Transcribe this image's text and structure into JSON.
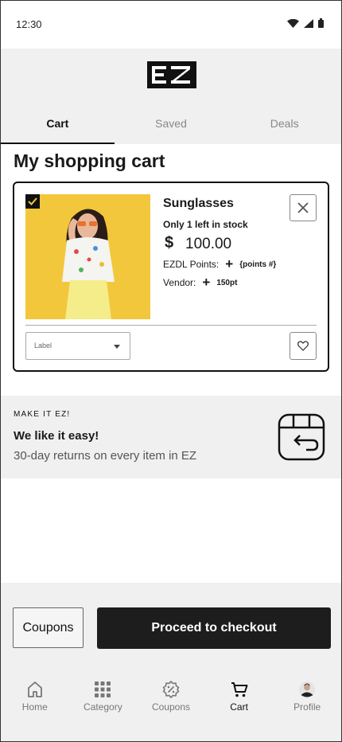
{
  "status": {
    "time": "12:30"
  },
  "brand": {
    "logo_text": "EZ"
  },
  "tabs": [
    {
      "label": "Cart",
      "active": true
    },
    {
      "label": "Saved",
      "active": false
    },
    {
      "label": "Deals",
      "active": false
    }
  ],
  "page": {
    "title": "My shopping cart"
  },
  "cart_item": {
    "checked": true,
    "name": "Sunglasses",
    "stock_note": "Only 1 left in stock",
    "currency_symbol": "$",
    "price": "100.00",
    "points_label": "EZDL Points:",
    "points_value": "{points #}",
    "vendor_label": "Vendor:",
    "vendor_value": "150pt",
    "select_label": "Label",
    "image_icon": "product-photo"
  },
  "promo": {
    "eyebrow": "MAKE IT EZ!",
    "title": "We like it easy!",
    "text": "30-day returns on every item in EZ",
    "icon": "return-box-icon"
  },
  "actions": {
    "coupons_label": "Coupons",
    "checkout_label": "Proceed to checkout"
  },
  "bottom_nav": [
    {
      "label": "Home",
      "icon": "home-icon",
      "active": false
    },
    {
      "label": "Category",
      "icon": "grid-icon",
      "active": false
    },
    {
      "label": "Coupons",
      "icon": "discount-badge-icon",
      "active": false
    },
    {
      "label": "Cart",
      "icon": "cart-icon",
      "active": true
    },
    {
      "label": "Profile",
      "icon": "avatar-icon",
      "active": false
    }
  ],
  "colors": {
    "accent": "#1d1d1d",
    "panel": "#f0f0f0",
    "product_bg": "#f2c73b"
  }
}
